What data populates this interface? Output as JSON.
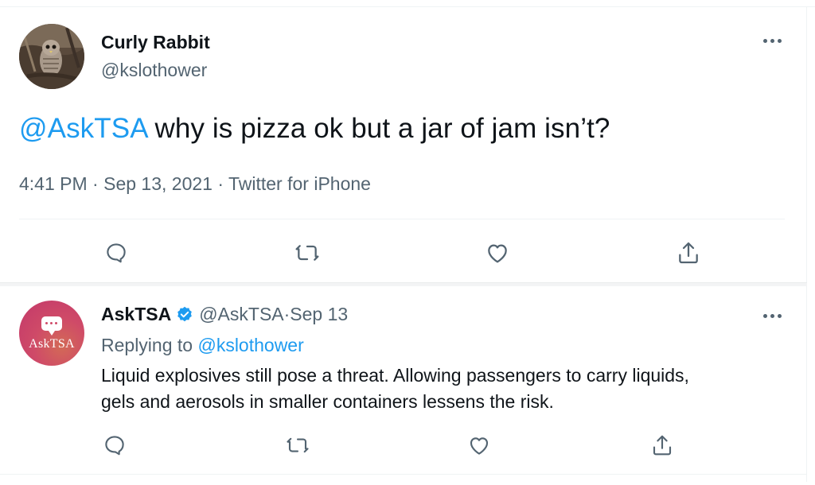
{
  "main_tweet": {
    "display_name": "Curly Rabbit",
    "handle": "@kslothower",
    "mention": "@AskTSA",
    "text": " why is pizza ok but a jar of jam isn’t?",
    "time": "4:41 PM",
    "sep1": " · ",
    "date": "Sep 13, 2021",
    "sep2": " · ",
    "source": "Twitter for iPhone",
    "avatar": "owl-photo",
    "actions": [
      "reply-icon",
      "retweet-icon",
      "like-icon",
      "share-icon"
    ]
  },
  "reply": {
    "display_name": "AskTSA",
    "handle": "@AskTSA",
    "date_sep": " · ",
    "date": "Sep 13",
    "replying_prefix": "Replying to ",
    "replying_to": "@kslothower",
    "body_line1": "Liquid explosives still pose a threat. Allowing passengers to carry liquids,",
    "body_line2": "gels and aerosols in smaller containers lessens the risk.",
    "avatar_label": "AskTSA",
    "verified": "verified-badge-icon",
    "actions": [
      "reply-icon",
      "retweet-icon",
      "like-icon",
      "share-icon"
    ]
  },
  "colors": {
    "text": "#0f1419",
    "secondary": "#536471",
    "link": "#1d9bf0",
    "divider": "#eff3f4",
    "asktsa_avatar": "#cf4a68"
  }
}
